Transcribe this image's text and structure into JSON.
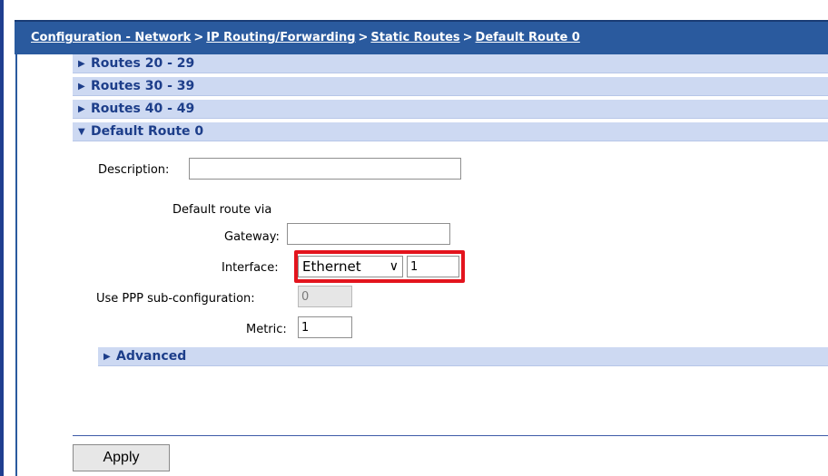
{
  "breadcrumb": {
    "items": [
      "Configuration - Network",
      "IP Routing/Forwarding",
      "Static Routes",
      "Default Route 0"
    ],
    "separator": ">"
  },
  "sections": {
    "routes_20": {
      "label": "Routes 20 - 29",
      "icon": "triangle-right-icon"
    },
    "routes_30": {
      "label": "Routes 30 - 39",
      "icon": "triangle-right-icon"
    },
    "routes_40": {
      "label": "Routes 40 - 49",
      "icon": "triangle-right-icon"
    },
    "default_route": {
      "label": "Default Route 0",
      "icon": "triangle-down-icon"
    },
    "advanced": {
      "label": "Advanced",
      "icon": "triangle-right-icon"
    }
  },
  "form": {
    "description_label": "Description:",
    "description_value": "",
    "default_route_via": "Default route via",
    "gateway_label": "Gateway:",
    "gateway_value": "",
    "interface_label": "Interface:",
    "interface_selected": "Ethernet",
    "interface_number": "1",
    "ppp_label": "Use PPP sub-configuration:",
    "ppp_value": "0",
    "metric_label": "Metric:",
    "metric_value": "1"
  },
  "buttons": {
    "apply": "Apply"
  },
  "colors": {
    "breadcrumb_bar": "#2a5a9e",
    "accordion_bg": "#cdd9f2",
    "accordion_text": "#1d3e8a",
    "highlight": "#e3141d"
  }
}
